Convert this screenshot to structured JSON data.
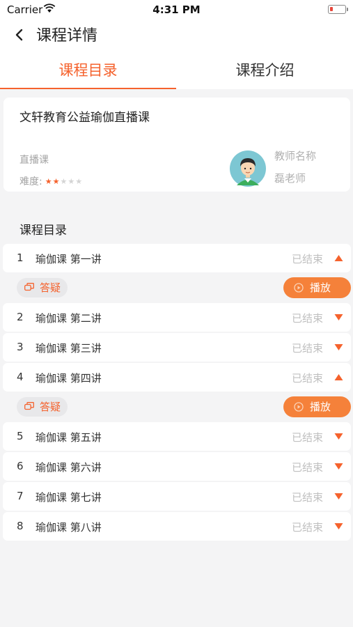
{
  "status_bar": {
    "carrier": "Carrier",
    "time": "4:31 PM"
  },
  "nav": {
    "title": "课程详情"
  },
  "tabs": [
    {
      "label": "课程目录",
      "active": true
    },
    {
      "label": "课程介绍",
      "active": false
    }
  ],
  "course": {
    "title": "文轩教育公益瑜伽直播课",
    "type": "直播课",
    "difficulty_label": "难度:",
    "difficulty_stars": 2,
    "difficulty_max": 5,
    "teacher_label": "教师名称",
    "teacher_name": "磊老师"
  },
  "catalog": {
    "section_title": "课程目录",
    "qa_label": "答疑",
    "play_label": "播放",
    "lessons": [
      {
        "num": "1",
        "name": "瑜伽课 第一讲",
        "status": "已结束",
        "expanded": true
      },
      {
        "num": "2",
        "name": "瑜伽课 第二讲",
        "status": "已结束",
        "expanded": false
      },
      {
        "num": "3",
        "name": "瑜伽课 第三讲",
        "status": "已结束",
        "expanded": false
      },
      {
        "num": "4",
        "name": "瑜伽课 第四讲",
        "status": "已结束",
        "expanded": true
      },
      {
        "num": "5",
        "name": "瑜伽课 第五讲",
        "status": "已结束",
        "expanded": false
      },
      {
        "num": "6",
        "name": "瑜伽课 第六讲",
        "status": "已结束",
        "expanded": false
      },
      {
        "num": "7",
        "name": "瑜伽课 第七讲",
        "status": "已结束",
        "expanded": false
      },
      {
        "num": "8",
        "name": "瑜伽课 第八讲",
        "status": "已结束",
        "expanded": false
      }
    ]
  },
  "colors": {
    "accent": "#f5622d",
    "play_button": "#f5813a",
    "muted_text": "#c0c0c0"
  }
}
